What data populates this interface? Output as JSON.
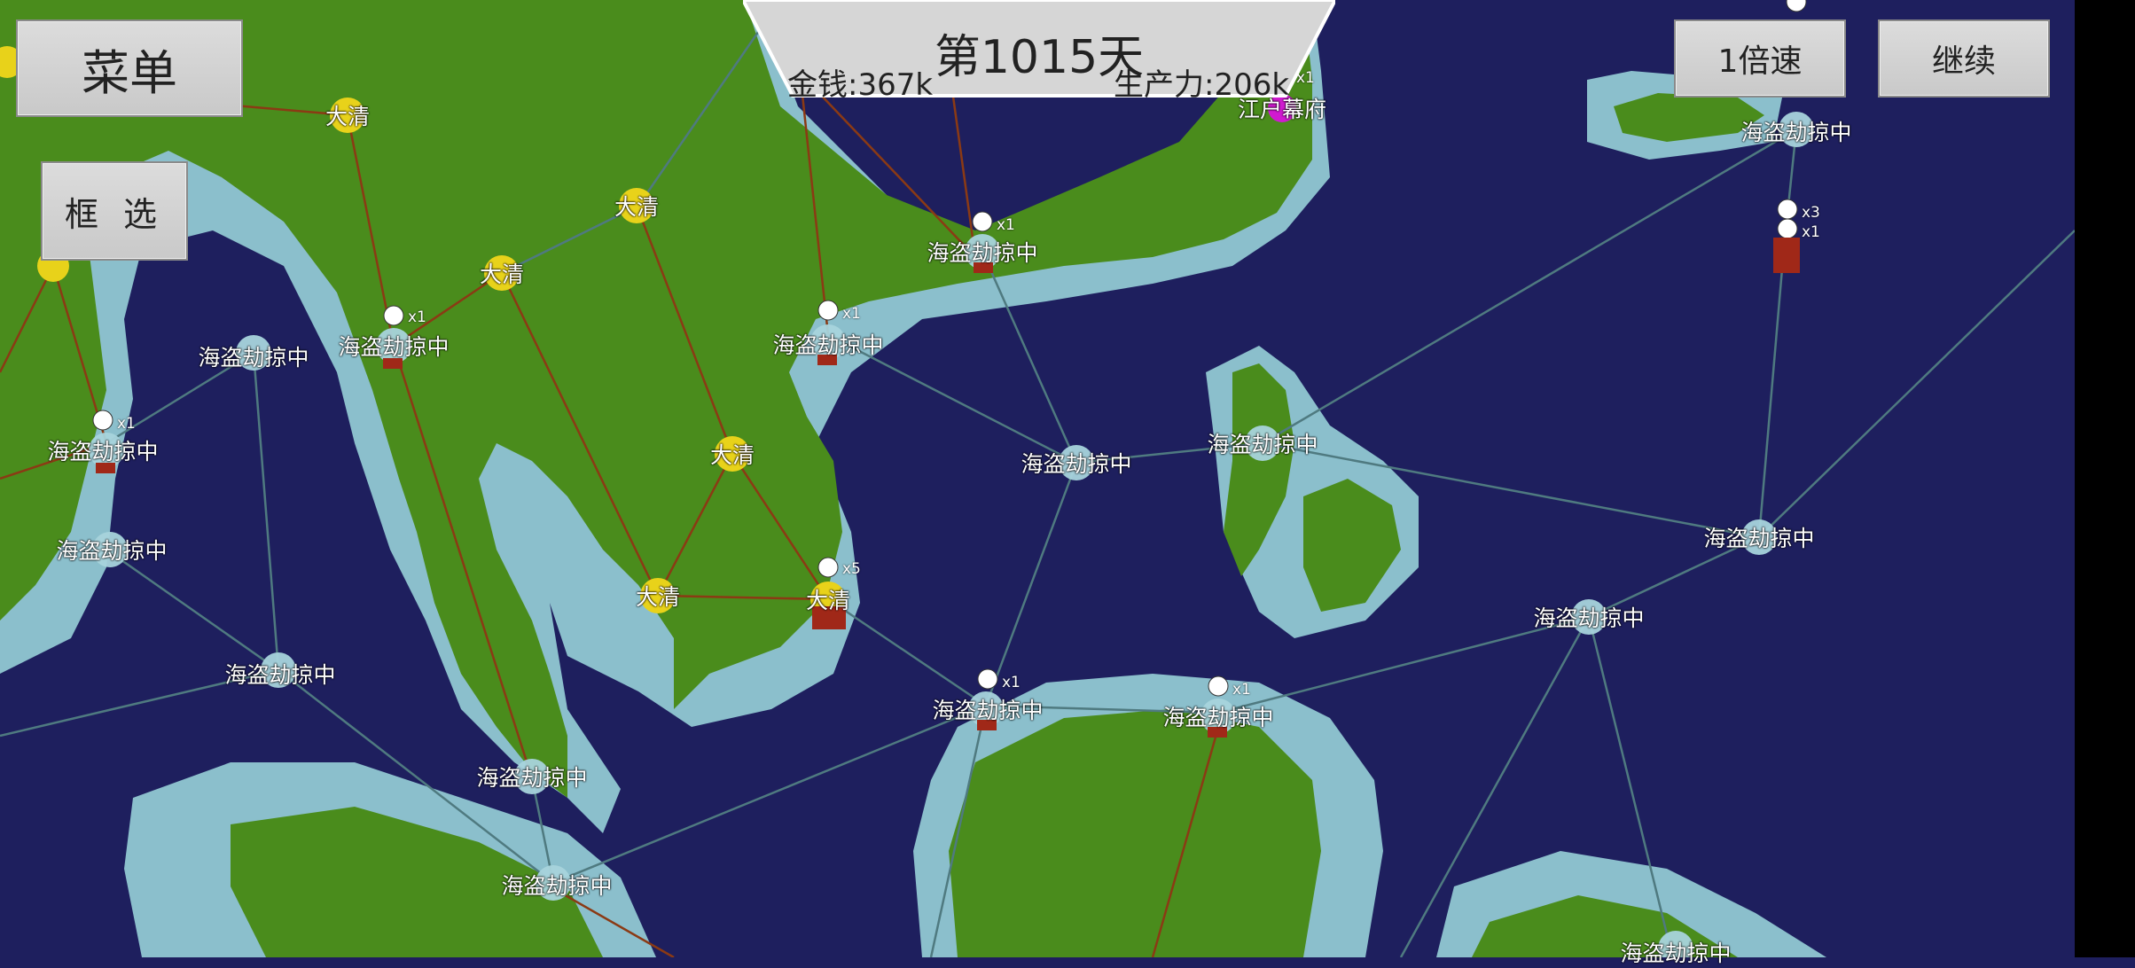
{
  "hud": {
    "menu_label": "菜单",
    "select_label": "框 选",
    "speed_label": "1倍速",
    "continue_label": "继续",
    "day_label": "第1015天",
    "money_label": "金钱:367k",
    "production_label": "生产力:206k"
  },
  "colors": {
    "ocean": "#1e1f5e",
    "shallow": "#8bbfcc",
    "land": "#4a8c1c",
    "route_land": "#8b3a14",
    "route_sea": "#4f7a80",
    "qing_node": "#e8d21a",
    "pirate_node": "#a8d4dc",
    "edo_node": "#d01ad0"
  },
  "map": {
    "pirate_label": "海盗劫掠中",
    "qing_label": "大清",
    "edo_label": "江户幕府",
    "army_counts": [
      "x1",
      "x1",
      "x1",
      "x1",
      "x1",
      "x1",
      "x3",
      "x1",
      "x5",
      "x1"
    ]
  }
}
